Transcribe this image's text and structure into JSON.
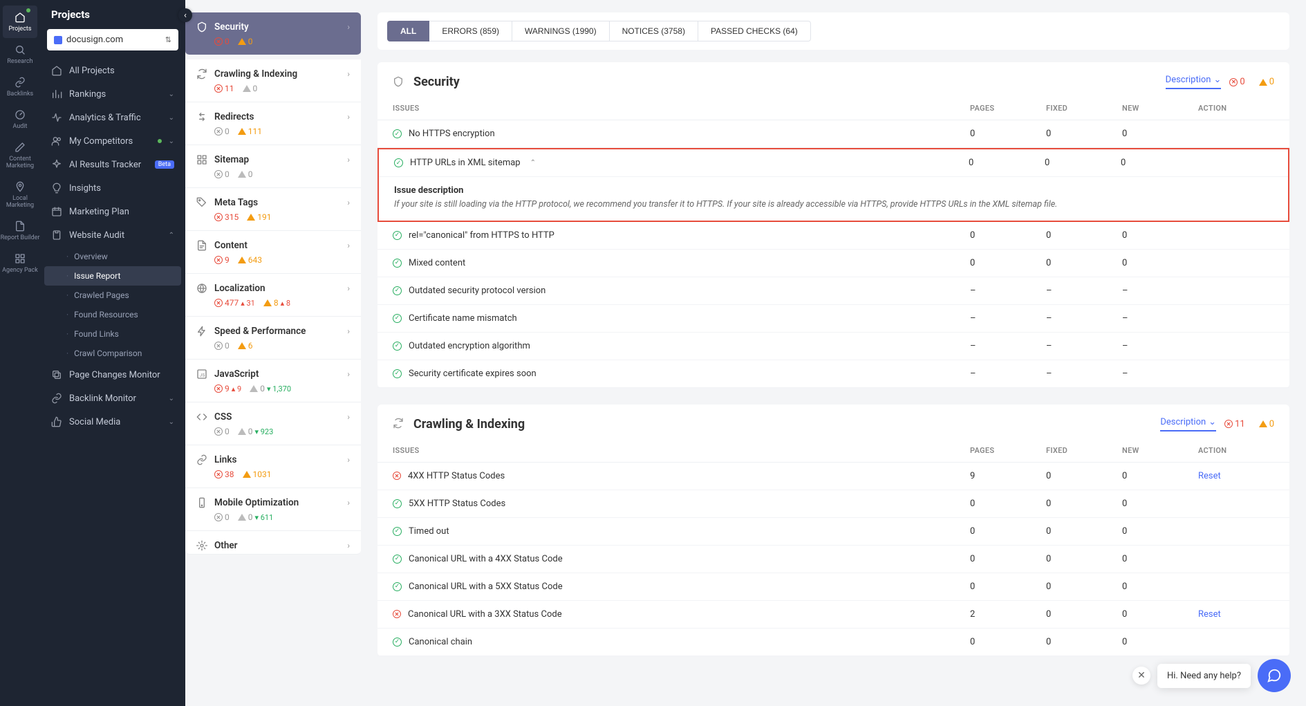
{
  "rail": [
    {
      "icon": "home",
      "label": "Projects",
      "active": true,
      "dot": true
    },
    {
      "icon": "search",
      "label": "Research"
    },
    {
      "icon": "link",
      "label": "Backlinks"
    },
    {
      "icon": "gauge",
      "label": "Audit"
    },
    {
      "icon": "edit",
      "label": "Content Marketing"
    },
    {
      "icon": "pin",
      "label": "Local Marketing"
    },
    {
      "icon": "doc",
      "label": "Report Builder"
    },
    {
      "icon": "grid",
      "label": "Agency Pack"
    }
  ],
  "side_header": "Projects",
  "project": "docusign.com",
  "nav": [
    {
      "icon": "home",
      "label": "All Projects"
    },
    {
      "icon": "bars",
      "label": "Rankings",
      "chev": true
    },
    {
      "icon": "pulse",
      "label": "Analytics & Traffic",
      "chev": true
    },
    {
      "icon": "users",
      "label": "My Competitors",
      "chev": true,
      "green_dot": true
    },
    {
      "icon": "sparkle",
      "label": "AI Results Tracker",
      "badge": "Beta"
    },
    {
      "icon": "bulb",
      "label": "Insights"
    },
    {
      "icon": "cal",
      "label": "Marketing Plan"
    },
    {
      "icon": "clip",
      "label": "Website Audit",
      "chev": true,
      "open": true,
      "chev_up": true
    }
  ],
  "audit_sub": [
    {
      "label": "Overview"
    },
    {
      "label": "Issue Report",
      "active": true
    },
    {
      "label": "Crawled Pages"
    },
    {
      "label": "Found Resources"
    },
    {
      "label": "Found Links"
    },
    {
      "label": "Crawl Comparison"
    }
  ],
  "nav_tail": [
    {
      "icon": "copy",
      "label": "Page Changes Monitor"
    },
    {
      "icon": "link",
      "label": "Backlink Monitor",
      "chev": true
    },
    {
      "icon": "thumb",
      "label": "Social Media",
      "chev": true
    }
  ],
  "filters": [
    {
      "label": "ALL",
      "active": true
    },
    {
      "label": "ERRORS (859)"
    },
    {
      "label": "WARNINGS (1990)"
    },
    {
      "label": "NOTICES (3758)"
    },
    {
      "label": "PASSED CHECKS (64)"
    }
  ],
  "categories": [
    {
      "icon": "shield",
      "label": "Security",
      "err": "0",
      "warn": "0",
      "active": true
    },
    {
      "icon": "refresh",
      "label": "Crawling & Indexing",
      "err": "11",
      "warn": "0",
      "warn_gray": true
    },
    {
      "icon": "arrows",
      "label": "Redirects",
      "err": "0",
      "err_gray": true,
      "warn": "111"
    },
    {
      "icon": "grid",
      "label": "Sitemap",
      "err": "0",
      "err_gray": true,
      "warn": "0",
      "warn_gray": true
    },
    {
      "icon": "tag",
      "label": "Meta Tags",
      "err": "315",
      "warn": "191"
    },
    {
      "icon": "file",
      "label": "Content",
      "err": "9",
      "warn": "643"
    },
    {
      "icon": "globe",
      "label": "Localization",
      "err": "477",
      "err_delta": "▴ 31",
      "warn": "8",
      "warn_delta": "▴ 8"
    },
    {
      "icon": "bolt",
      "label": "Speed & Performance",
      "err": "0",
      "err_gray": true,
      "warn": "6"
    },
    {
      "icon": "js",
      "label": "JavaScript",
      "err": "9",
      "err_delta": "▴ 9",
      "warn": "0",
      "warn_gray": true,
      "warn_delta_dn": "▾ 1,370"
    },
    {
      "icon": "code",
      "label": "CSS",
      "err": "0",
      "err_gray": true,
      "warn": "0",
      "warn_gray": true,
      "warn_delta_dn": "▾ 923"
    },
    {
      "icon": "link",
      "label": "Links",
      "err": "38",
      "warn": "1031"
    },
    {
      "icon": "mobile",
      "label": "Mobile Optimization",
      "err": "0",
      "err_gray": true,
      "warn": "0",
      "warn_gray": true,
      "warn_delta_dn": "▾ 611"
    },
    {
      "icon": "gear",
      "label": "Other"
    }
  ],
  "sections": [
    {
      "icon": "shield",
      "title": "Security",
      "desc_label": "Description",
      "err_total": "0",
      "warn_total": "0",
      "headers": {
        "issues": "ISSUES",
        "pages": "PAGES",
        "fixed": "FIXED",
        "new": "NEW",
        "action": "ACTION"
      },
      "rows": [
        {
          "status": "ok",
          "label": "No HTTPS encryption",
          "pages": "0",
          "fixed": "0",
          "new": "0"
        },
        {
          "status": "ok",
          "label": "HTTP URLs in XML sitemap",
          "expanded": true,
          "pages": "0",
          "fixed": "0",
          "new": "0",
          "highlight": true,
          "desc_title": "Issue description",
          "desc_body": "If your site is still loading via the HTTP protocol, we recommend you transfer it to HTTPS. If your site is already accessible via HTTPS, provide HTTPS URLs in the XML sitemap file."
        },
        {
          "status": "ok",
          "label": "rel=\"canonical\" from HTTPS to HTTP",
          "pages": "0",
          "fixed": "0",
          "new": "0"
        },
        {
          "status": "ok",
          "label": "Mixed content",
          "pages": "0",
          "fixed": "0",
          "new": "0"
        },
        {
          "status": "ok",
          "label": "Outdated security protocol version",
          "pages": "–",
          "fixed": "–",
          "new": "–"
        },
        {
          "status": "ok",
          "label": "Certificate name mismatch",
          "pages": "–",
          "fixed": "–",
          "new": "–"
        },
        {
          "status": "ok",
          "label": "Outdated encryption algorithm",
          "pages": "–",
          "fixed": "–",
          "new": "–"
        },
        {
          "status": "ok",
          "label": "Security certificate expires soon",
          "pages": "–",
          "fixed": "–",
          "new": "–"
        }
      ]
    },
    {
      "icon": "refresh",
      "title": "Crawling & Indexing",
      "desc_label": "Description",
      "err_total": "11",
      "warn_total": "0",
      "headers": {
        "issues": "ISSUES",
        "pages": "PAGES",
        "fixed": "FIXED",
        "new": "NEW",
        "action": "ACTION"
      },
      "rows": [
        {
          "status": "err",
          "label": "4XX HTTP Status Codes",
          "pages": "9",
          "fixed": "0",
          "new": "0",
          "action": "Reset"
        },
        {
          "status": "ok",
          "label": "5XX HTTP Status Codes",
          "pages": "0",
          "fixed": "0",
          "new": "0"
        },
        {
          "status": "ok",
          "label": "Timed out",
          "pages": "0",
          "fixed": "0",
          "new": "0"
        },
        {
          "status": "ok",
          "label": "Canonical URL with a 4XX Status Code",
          "pages": "0",
          "fixed": "0",
          "new": "0"
        },
        {
          "status": "ok",
          "label": "Canonical URL with a 5XX Status Code",
          "pages": "0",
          "fixed": "0",
          "new": "0"
        },
        {
          "status": "err",
          "label": "Canonical URL with a 3XX Status Code",
          "pages": "2",
          "fixed": "0",
          "new": "0",
          "action": "Reset"
        },
        {
          "status": "ok",
          "label": "Canonical chain",
          "pages": "0",
          "fixed": "0",
          "new": "0"
        }
      ]
    }
  ],
  "chat_msg": "Hi. Need any help?"
}
